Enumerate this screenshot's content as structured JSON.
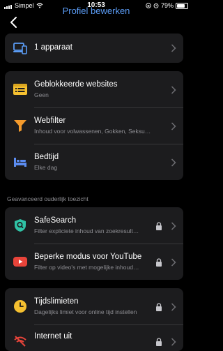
{
  "status": {
    "carrier": "Simpel",
    "time": "10:53",
    "battery": "79%"
  },
  "header": {
    "title": "Profiel bewerken"
  },
  "devices": {
    "label": "1 apparaat"
  },
  "filters": [
    {
      "title": "Geblokkeerde websites",
      "subtitle": "Geen",
      "icon": "browser-list-icon"
    },
    {
      "title": "Webfilter",
      "subtitle": "Inhoud voor volwassenen, Gokken, Seksu…",
      "icon": "funnel-icon"
    },
    {
      "title": "Bedtijd",
      "subtitle": "Elke dag",
      "icon": "bed-icon"
    }
  ],
  "advanced": {
    "section_label": "Geavanceerd ouderlijk toezicht",
    "items": [
      {
        "title": "SafeSearch",
        "subtitle": "Filter expliciete inhoud van zoekresult…",
        "locked": true
      },
      {
        "title": "Beperke modus voor YouTube",
        "subtitle": "Filter op video's met mogelijke inhoud…",
        "locked": true
      }
    ]
  },
  "time": {
    "items": [
      {
        "title": "Tijdslimieten",
        "subtitle": "Dagelijks limiet voor online tijd instellen",
        "locked": true
      },
      {
        "title": "Internet uit",
        "subtitle": "",
        "locked": true
      }
    ]
  },
  "colors": {
    "accent": "#5b9cf5",
    "card": "#1c1c1e",
    "yellow": "#f5c030",
    "orange": "#f39a2c",
    "blue": "#5b8cf0",
    "teal": "#2fc2a5",
    "red": "#e8443a"
  }
}
